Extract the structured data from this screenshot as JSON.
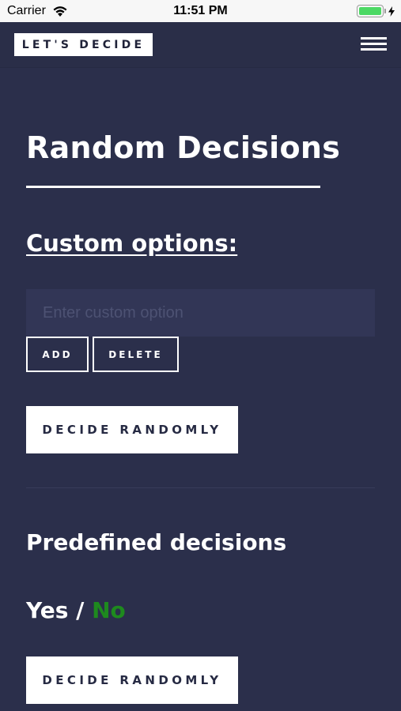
{
  "status_bar": {
    "carrier": "Carrier",
    "time": "11:51 PM",
    "battery_level": 1.0,
    "battery_color": "#4cd964"
  },
  "header": {
    "logo_text": "LET'S DECIDE",
    "menu_icon": "hamburger-menu-icon"
  },
  "main": {
    "title": "Random Decisions",
    "custom_heading": "Custom options:",
    "custom_input": {
      "value": "",
      "placeholder": "Enter custom option"
    },
    "add_label": "ADD",
    "delete_label": "DELETE",
    "decide_label": "DECIDE RANDOMLY",
    "predefined_heading": "Predefined decisions",
    "predefined_options": {
      "yes": "Yes",
      "separator": " / ",
      "no": "No",
      "selected_color": "#1e8a1e"
    },
    "decide_label_2": "DECIDE RANDOMLY"
  },
  "colors": {
    "background": "#2b2f4b",
    "accent": "#ffffff"
  }
}
